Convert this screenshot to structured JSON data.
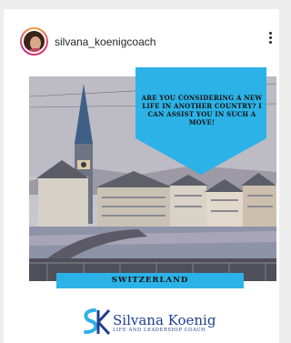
{
  "post": {
    "username": "silvana_koenigcoach",
    "more_icon": "more-vertical-icon"
  },
  "image": {
    "callout_text": "ARE YOU CONSIDERING A NEW LIFE IN ANOTHER COUNTRY? I CAN ASSIST YOU IN SUCH A MOVE!",
    "banner_text": "SWITZERLAND",
    "logo_name": "Silvana Koenig",
    "logo_tagline": "LIFE AND LEADERSHIP COACH",
    "colors": {
      "accent": "#2cb2e6",
      "logo_blue": "#1f3f8f"
    }
  }
}
